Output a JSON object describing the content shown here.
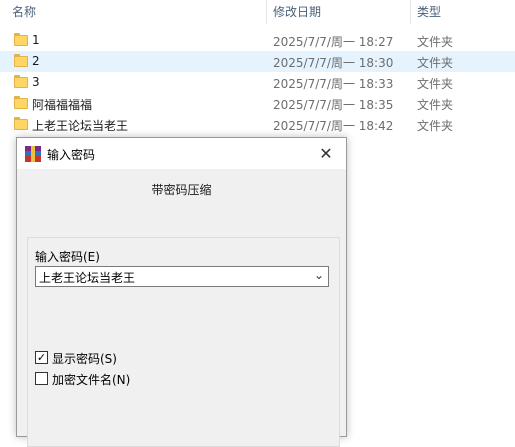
{
  "columns": {
    "name": "名称",
    "date": "修改日期",
    "type": "类型"
  },
  "files": [
    {
      "name": "1",
      "date": "2025/7/7/周一 18:27",
      "type": "文件夹",
      "selected": false
    },
    {
      "name": "2",
      "date": "2025/7/7/周一 18:30",
      "type": "文件夹",
      "selected": true
    },
    {
      "name": "3",
      "date": "2025/7/7/周一 18:33",
      "type": "文件夹",
      "selected": false
    },
    {
      "name": "阿福福福福",
      "date": "2025/7/7/周一 18:35",
      "type": "文件夹",
      "selected": false
    },
    {
      "name": "上老王论坛当老王",
      "date": "2025/7/7/周一 18:42",
      "type": "文件夹",
      "selected": false
    }
  ],
  "dialog": {
    "title": "输入密码",
    "close_glyph": "✕",
    "subtitle": "带密码压缩",
    "password_label": "输入密码(E)",
    "password_value": "上老王论坛当老王",
    "dropdown_glyph": "⌄",
    "show_password": {
      "label": "显示密码(S)",
      "checked": true
    },
    "encrypt_names": {
      "label": "加密文件名(N)",
      "checked": false
    }
  },
  "icons": {
    "folder": "folder-icon",
    "app": "winrar-icon",
    "close": "close-icon",
    "dropdown": "chevron-down-icon"
  },
  "colors": {
    "selection": "#e5f3ff",
    "folder": "#ffd564",
    "header_text": "#4c607a"
  }
}
